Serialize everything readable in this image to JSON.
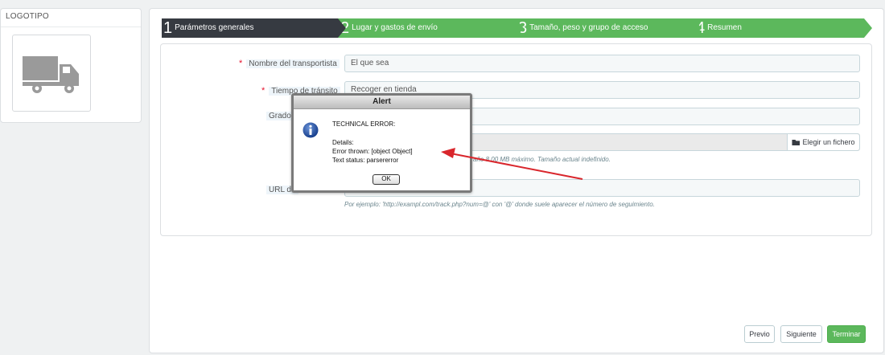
{
  "logo_panel": {
    "title": "LOGOTIPO",
    "icon": "truck-icon"
  },
  "steps": [
    {
      "num": "1",
      "label": "Parámetros generales",
      "active": true
    },
    {
      "num": "2",
      "label": "Lugar y gastos de envío",
      "active": false
    },
    {
      "num": "3",
      "label": "Tamaño, peso y grupo de acceso",
      "active": false
    },
    {
      "num": "4",
      "label": "Resumen",
      "active": false
    }
  ],
  "form": {
    "carrier_name_label": "Nombre del transportista",
    "carrier_name_value": "El que sea",
    "transit_time_label": "Tiempo de tránsito",
    "transit_time_value": "Recoger en tienda",
    "speed_grade_label": "Grado",
    "file_button": "Elegir un fichero",
    "file_help": "año 8.00 MB máximo. Tamaño actual indefinido.",
    "tracking_url_label": "URL de",
    "tracking_url_help": "Por ejemplo: 'http://exampl.com/track.php?num=@' con '@' donde suele aparecer el número de seguimiento."
  },
  "alert": {
    "title": "Alert",
    "line1": "TECHNICAL ERROR:",
    "line2": "Details:",
    "line3": "Error thrown: [object Object]",
    "line4": "Text status: parsererror",
    "ok": "OK",
    "icon": "info-icon"
  },
  "buttons": {
    "prev": "Previo",
    "next": "Siguiente",
    "finish": "Terminar"
  },
  "colors": {
    "step_active": "#363a41",
    "step_inactive": "#5cb85c",
    "required": "#e4122d",
    "arrow": "#d9262c"
  }
}
